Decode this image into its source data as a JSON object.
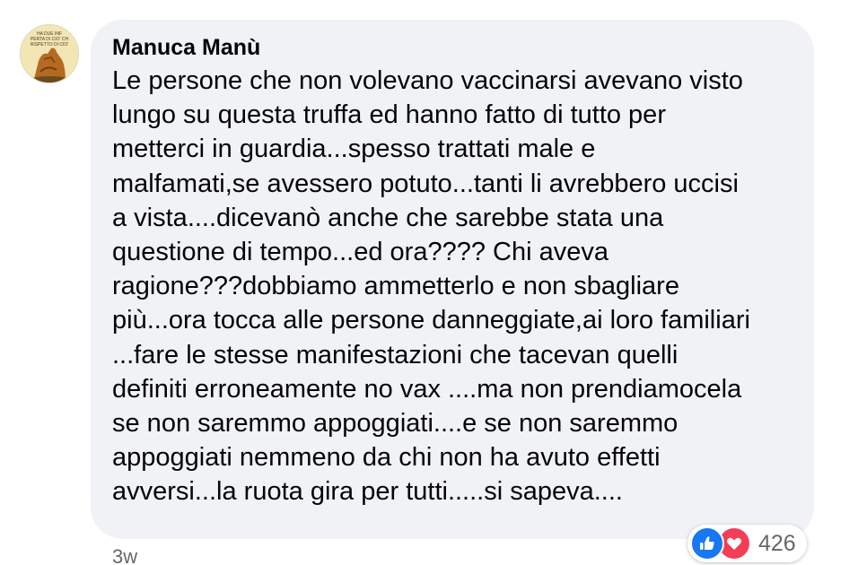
{
  "comment": {
    "author": "Manuca Manù",
    "avatar_caption": [
      "HA DUE INF",
      "PERTA DI CIO' CH",
      "RISPETTO DI CIO'"
    ],
    "lines": [
      "Le persone che non volevano vaccinarsi avevano visto",
      "lungo su questa truffa ed hanno fatto di tutto per",
      "metterci in guardia...spesso trattati male e",
      "malfamati,se avessero potuto...tanti li avrebbero uccisi",
      "a vista....dicevanò anche che sarebbe stata una",
      "questione di tempo...ed ora???? Chi aveva",
      "ragione???dobbiamo ammetterlo e non sbagliare",
      "più...ora tocca alle persone danneggiate,ai loro familiari",
      "...fare le stesse manifestazioni che tacevan quelli",
      "definiti erroneamente no vax ....ma non prendiamocela",
      "se non saremmo appoggiati....e se non saremmo",
      "appoggiati nemmeno da chi non ha avuto effetti",
      "avversi...la ruota gira per tutti.....si sapeva...."
    ],
    "timestamp": "3w",
    "reactions": {
      "icons": [
        "thumbs-up-icon",
        "heart-icon"
      ],
      "count": "426",
      "like_color": "#1877f2",
      "love_color": "#f33e58"
    }
  },
  "colors": {
    "bubble_bg": "#f0f2f5",
    "text": "#050505",
    "secondary_text": "#65676b"
  }
}
